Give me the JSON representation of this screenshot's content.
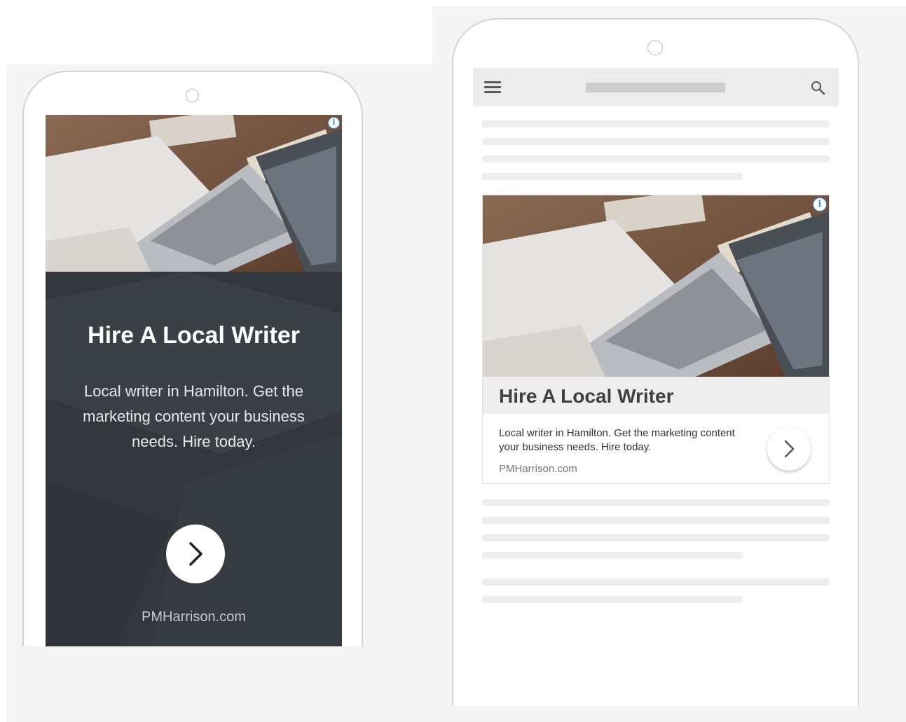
{
  "ad": {
    "headline": "Hire A Local Writer",
    "body": "Local writer in Hamilton. Get the marketing content your business needs. Hire today.",
    "display_url": "PMHarrison.com",
    "info_icon": "info-icon",
    "cta_icon": "chevron-right-icon"
  },
  "right_topbar": {
    "menu_icon": "hamburger-menu-icon",
    "search_icon": "search-icon"
  },
  "colors": {
    "ad_dark_bg": "#33373d",
    "info_icon_accent": "#3d8fd9",
    "placeholder_line": "#eeeeee",
    "topbar_bg": "#ececec"
  }
}
